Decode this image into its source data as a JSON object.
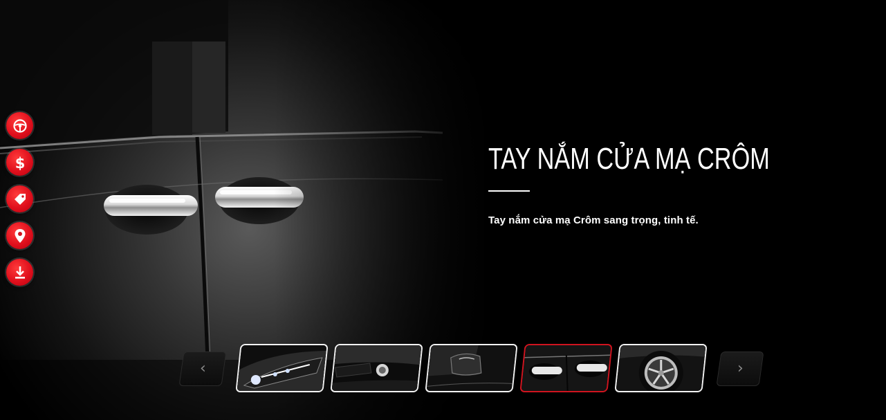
{
  "feature": {
    "title": "TAY NẮM CỬA MẠ CRÔM",
    "description": "Tay nắm cửa mạ Crôm sang trọng, tinh tế."
  },
  "side_tools": [
    {
      "name": "steering-wheel-icon",
      "label": "test drive"
    },
    {
      "name": "dollar-icon",
      "label": "price"
    },
    {
      "name": "tag-icon",
      "label": "promotion"
    },
    {
      "name": "location-pin-icon",
      "label": "dealer location"
    },
    {
      "name": "download-icon",
      "label": "download brochure"
    }
  ],
  "carousel": {
    "prev_icon": "chevron-left-icon",
    "next_icon": "chevron-right-icon",
    "thumbnails": [
      {
        "subject": "headlight",
        "active": false
      },
      {
        "subject": "fog-light",
        "active": false
      },
      {
        "subject": "side-mirror",
        "active": false
      },
      {
        "subject": "chrome-door-handle",
        "active": true
      },
      {
        "subject": "alloy-wheel",
        "active": false
      }
    ]
  },
  "colors": {
    "accent": "#e0101d",
    "active_border": "#d0141f",
    "background": "#000000",
    "text": "#ffffff"
  }
}
